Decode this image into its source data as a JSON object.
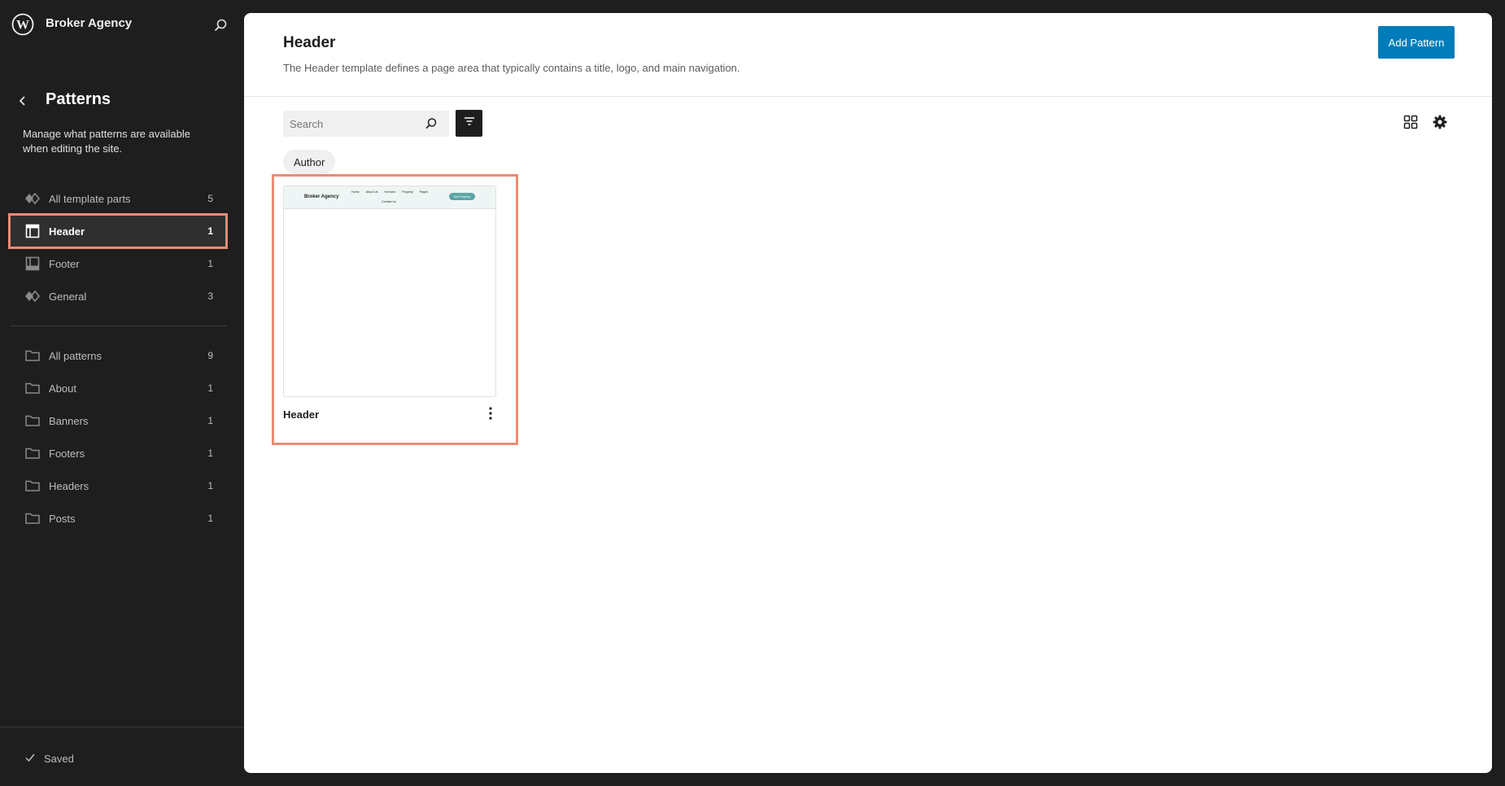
{
  "site": {
    "title": "Broker Agency",
    "logo_icon": "wordpress-logo-icon",
    "search_icon": "search-icon"
  },
  "sidebar": {
    "section_title": "Patterns",
    "description": "Manage what patterns are available when editing the site.",
    "template_parts": [
      {
        "label": "All template parts",
        "count": "5",
        "icon": "diamond-symbol-icon",
        "active": false
      },
      {
        "label": "Header",
        "count": "1",
        "icon": "header-layout-icon",
        "active": true
      },
      {
        "label": "Footer",
        "count": "1",
        "icon": "footer-layout-icon",
        "active": false
      },
      {
        "label": "General",
        "count": "3",
        "icon": "diamond-symbol-icon",
        "active": false
      }
    ],
    "categories": [
      {
        "label": "All patterns",
        "count": "9",
        "icon": "folder-icon"
      },
      {
        "label": "About",
        "count": "1",
        "icon": "folder-icon"
      },
      {
        "label": "Banners",
        "count": "1",
        "icon": "folder-icon"
      },
      {
        "label": "Footers",
        "count": "1",
        "icon": "folder-icon"
      },
      {
        "label": "Headers",
        "count": "1",
        "icon": "folder-icon"
      },
      {
        "label": "Posts",
        "count": "1",
        "icon": "folder-icon"
      }
    ],
    "status": "Saved"
  },
  "main": {
    "title": "Header",
    "description": "The Header template defines a page area that typically contains a title, logo, and main navigation.",
    "add_button": "Add Pattern",
    "search_placeholder": "Search",
    "filter_chip": "Author",
    "colors": {
      "accent": "#007cba",
      "highlight": "#e98c73",
      "sidebar_bg": "#1e1e1e"
    }
  },
  "card": {
    "title": "Header",
    "preview": {
      "brand": "Broker Agency",
      "nav": [
        "Home",
        "About Us",
        "Services",
        "Property",
        "Pages"
      ],
      "nav_second_row": "Contact Us",
      "button": "Sell Property"
    }
  }
}
